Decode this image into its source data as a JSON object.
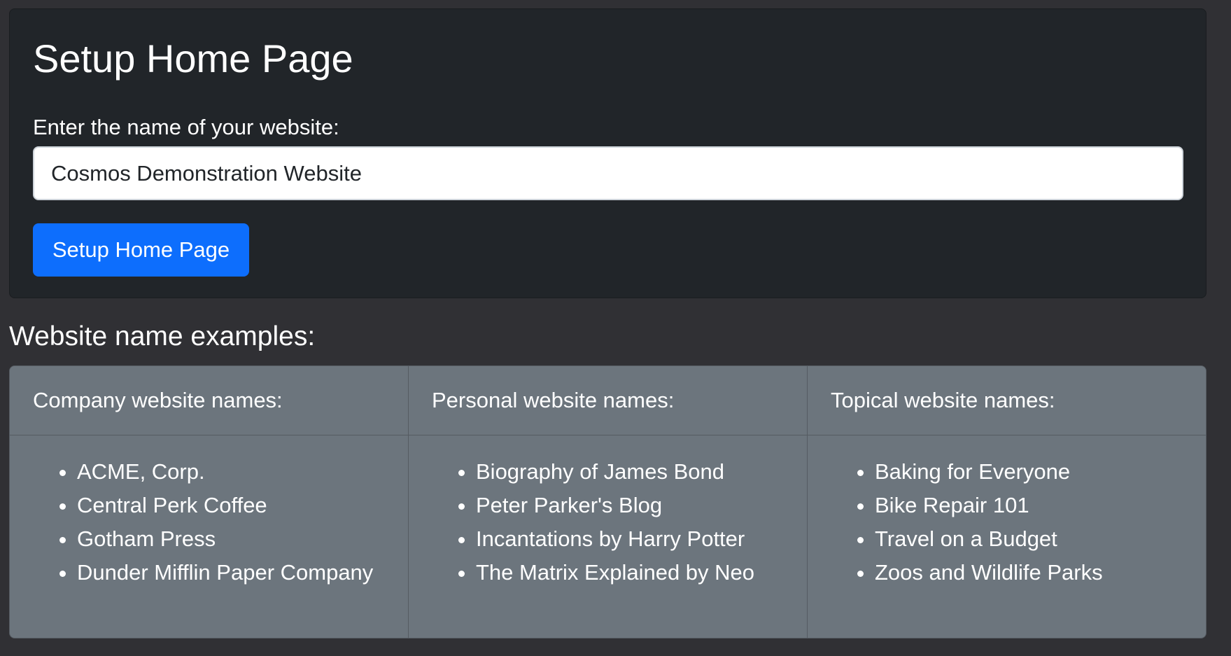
{
  "setup": {
    "title": "Setup Home Page",
    "label": "Enter the name of your website:",
    "input_value": "Cosmos Demonstration Website",
    "button_label": "Setup Home Page"
  },
  "examples": {
    "heading": "Website name examples:",
    "groups": [
      {
        "header": "Company website names:",
        "items": [
          "ACME, Corp.",
          "Central Perk Coffee",
          "Gotham Press",
          "Dunder Mifflin Paper Company"
        ]
      },
      {
        "header": "Personal website names:",
        "items": [
          "Biography of James Bond",
          "Peter Parker's Blog",
          "Incantations by Harry Potter",
          "The Matrix Explained by Neo"
        ]
      },
      {
        "header": "Topical website names:",
        "items": [
          "Baking for Everyone",
          "Bike Repair 101",
          "Travel on a Budget",
          "Zoos and Wildlife Parks"
        ]
      }
    ]
  },
  "colors": {
    "page_background": "#303034",
    "card_background": "#212529",
    "primary_button": "#0d6efd",
    "examples_background": "#6c757d"
  }
}
